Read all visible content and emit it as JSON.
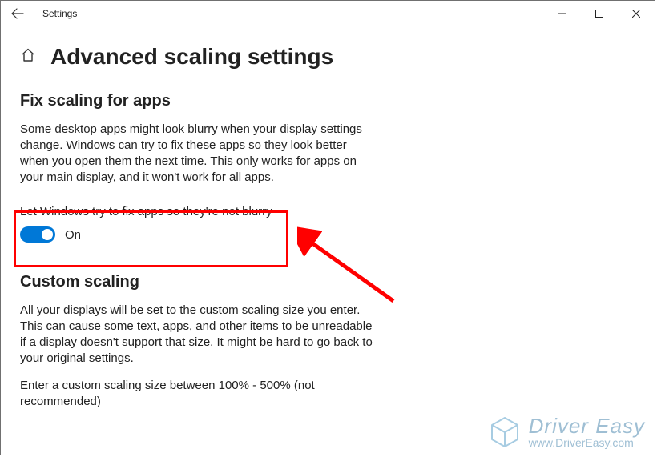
{
  "titlebar": {
    "app_name": "Settings"
  },
  "page": {
    "title": "Advanced scaling settings"
  },
  "section1": {
    "title": "Fix scaling for apps",
    "body": "Some desktop apps might look blurry when your display settings change. Windows can try to fix these apps so they look better when you open them the next time. This only works for apps on your main display, and it won't work for all apps.",
    "toggle_label": "Let Windows try to fix apps so they're not blurry",
    "toggle_state": "On"
  },
  "section2": {
    "title": "Custom scaling",
    "body": "All your displays will be set to the custom scaling size you enter. This can cause some text, apps, and other items to be unreadable if a display doesn't support that size. It might be hard to go back to your original settings.",
    "hint": "Enter a custom scaling size between 100% - 500% (not recommended)"
  },
  "watermark": {
    "line1": "Driver Easy",
    "line2": "www.DriverEasy.com"
  }
}
